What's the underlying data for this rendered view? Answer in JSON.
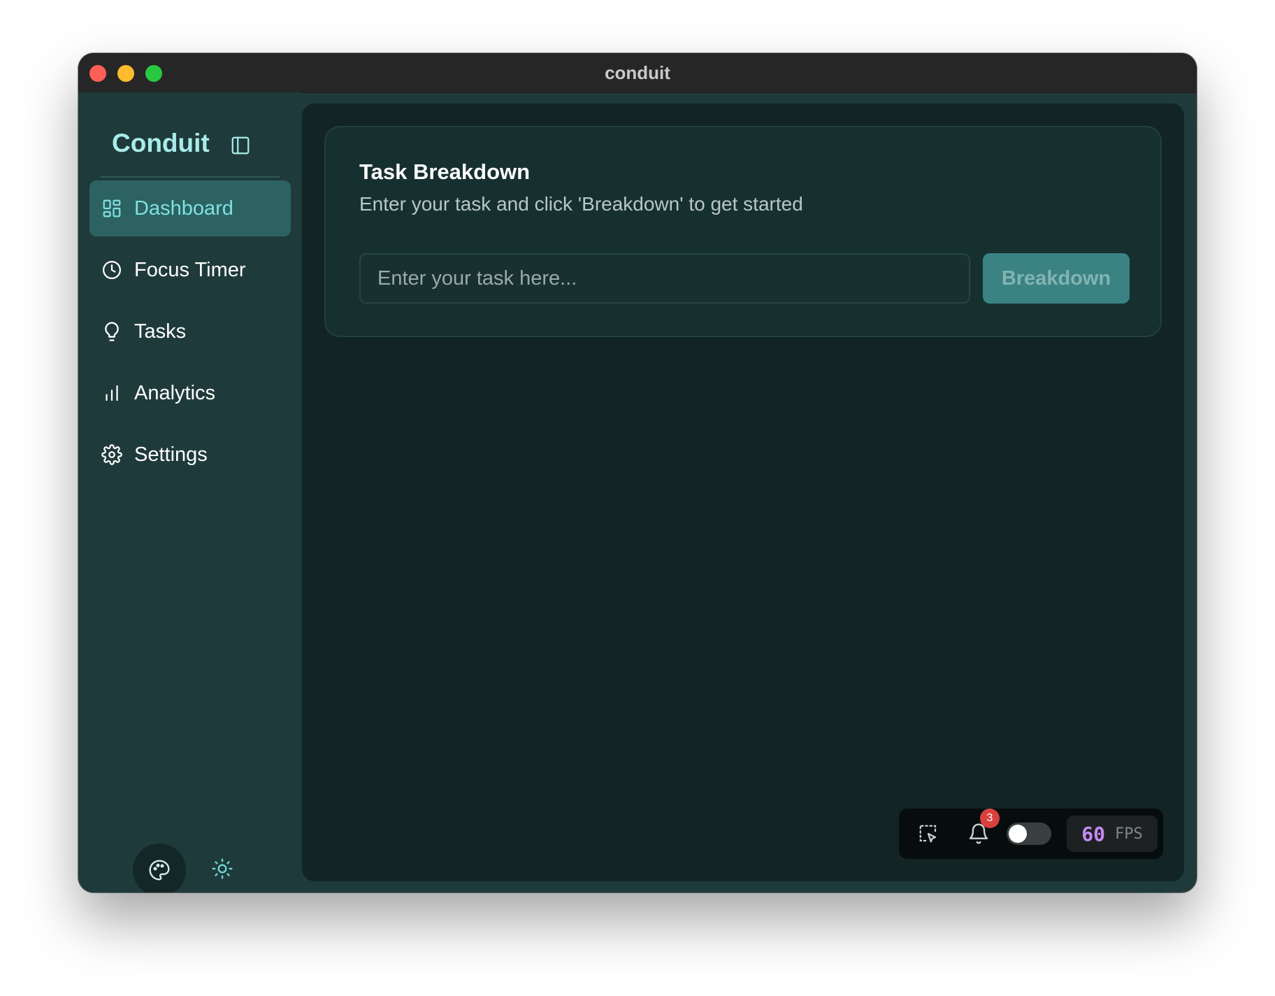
{
  "window": {
    "title": "conduit"
  },
  "sidebar": {
    "brand": "Conduit",
    "items": [
      {
        "label": "Dashboard",
        "icon": "dashboard-icon",
        "active": true
      },
      {
        "label": "Focus Timer",
        "icon": "clock-icon",
        "active": false
      },
      {
        "label": "Tasks",
        "icon": "lightbulb-icon",
        "active": false
      },
      {
        "label": "Analytics",
        "icon": "bar-chart-icon",
        "active": false
      },
      {
        "label": "Settings",
        "icon": "gear-icon",
        "active": false
      }
    ],
    "footer_icons": [
      "palette-icon",
      "sun-icon"
    ]
  },
  "main": {
    "card": {
      "title": "Task Breakdown",
      "subtitle": "Enter your task and click 'Breakdown' to get started",
      "input_placeholder": "Enter your task here...",
      "input_value": "",
      "button_label": "Breakdown"
    }
  },
  "devtools": {
    "notification_count": "3",
    "toggle_on": false,
    "fps_value": "60",
    "fps_label": "FPS"
  },
  "colors": {
    "accent": "#7fe0e0",
    "brand": "#a8ecec",
    "active_nav_bg": "#2d6262",
    "button_bg": "#3b8383",
    "badge": "#d9413f",
    "fps": "#c58af5"
  }
}
